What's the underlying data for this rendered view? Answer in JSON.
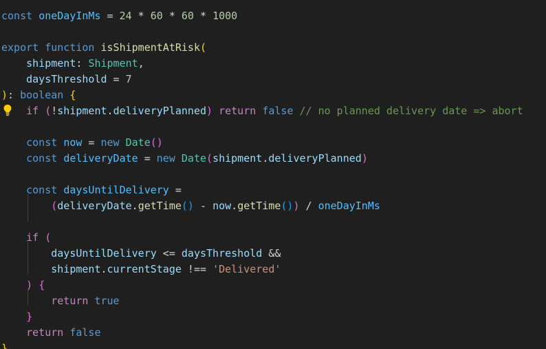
{
  "editor": {
    "lines": [
      [
        [
          "k",
          "const"
        ],
        [
          "p",
          " "
        ],
        [
          "cv",
          "oneDayInMs"
        ],
        [
          "p",
          " = "
        ],
        [
          "n",
          "24"
        ],
        [
          "p",
          " * "
        ],
        [
          "n",
          "60"
        ],
        [
          "p",
          " * "
        ],
        [
          "n",
          "60"
        ],
        [
          "p",
          " * "
        ],
        [
          "n",
          "1000"
        ]
      ],
      [],
      [
        [
          "k",
          "export"
        ],
        [
          "p",
          " "
        ],
        [
          "k",
          "function"
        ],
        [
          "p",
          " "
        ],
        [
          "fn",
          "isShipmentAtRisk"
        ],
        [
          "b1",
          "("
        ]
      ],
      [
        [
          "p",
          "    "
        ],
        [
          "v",
          "shipment"
        ],
        [
          "p",
          ": "
        ],
        [
          "ty",
          "Shipment"
        ],
        [
          "p",
          ","
        ]
      ],
      [
        [
          "p",
          "    "
        ],
        [
          "v",
          "daysThreshold"
        ],
        [
          "p",
          " = "
        ],
        [
          "n",
          "7"
        ]
      ],
      [
        [
          "b1",
          ")"
        ],
        [
          "p",
          ": "
        ],
        [
          "k",
          "boolean"
        ],
        [
          "p",
          " "
        ],
        [
          "b1",
          "{"
        ]
      ],
      [
        [
          "p",
          "    "
        ],
        [
          "kc",
          "if"
        ],
        [
          "p",
          " "
        ],
        [
          "b2",
          "("
        ],
        [
          "p",
          "!"
        ],
        [
          "v",
          "shipment"
        ],
        [
          "p",
          "."
        ],
        [
          "v",
          "deliveryPlanned"
        ],
        [
          "b2",
          ")"
        ],
        [
          "p",
          " "
        ],
        [
          "kc",
          "return"
        ],
        [
          "p",
          " "
        ],
        [
          "k",
          "false"
        ],
        [
          "p",
          " "
        ],
        [
          "c",
          "// no planned delivery date => abort"
        ]
      ],
      [],
      [
        [
          "p",
          "    "
        ],
        [
          "k",
          "const"
        ],
        [
          "p",
          " "
        ],
        [
          "cv",
          "now"
        ],
        [
          "p",
          " = "
        ],
        [
          "k",
          "new"
        ],
        [
          "p",
          " "
        ],
        [
          "ty",
          "Date"
        ],
        [
          "b2",
          "()"
        ]
      ],
      [
        [
          "p",
          "    "
        ],
        [
          "k",
          "const"
        ],
        [
          "p",
          " "
        ],
        [
          "cv",
          "deliveryDate"
        ],
        [
          "p",
          " = "
        ],
        [
          "k",
          "new"
        ],
        [
          "p",
          " "
        ],
        [
          "ty",
          "Date"
        ],
        [
          "b2",
          "("
        ],
        [
          "v",
          "shipment"
        ],
        [
          "p",
          "."
        ],
        [
          "v",
          "deliveryPlanned"
        ],
        [
          "b2",
          ")"
        ]
      ],
      [],
      [
        [
          "p",
          "    "
        ],
        [
          "k",
          "const"
        ],
        [
          "p",
          " "
        ],
        [
          "cv",
          "daysUntilDelivery"
        ],
        [
          "p",
          " ="
        ]
      ],
      [
        [
          "p",
          "        "
        ],
        [
          "b2",
          "("
        ],
        [
          "v",
          "deliveryDate"
        ],
        [
          "p",
          "."
        ],
        [
          "fn",
          "getTime"
        ],
        [
          "b3",
          "()"
        ],
        [
          "p",
          " - "
        ],
        [
          "v",
          "now"
        ],
        [
          "p",
          "."
        ],
        [
          "fn",
          "getTime"
        ],
        [
          "b3",
          "()"
        ],
        [
          "b2",
          ")"
        ],
        [
          "p",
          " / "
        ],
        [
          "cv",
          "oneDayInMs"
        ]
      ],
      [],
      [
        [
          "p",
          "    "
        ],
        [
          "kc",
          "if"
        ],
        [
          "p",
          " "
        ],
        [
          "b2",
          "("
        ]
      ],
      [
        [
          "p",
          "        "
        ],
        [
          "v",
          "daysUntilDelivery"
        ],
        [
          "p",
          " <= "
        ],
        [
          "v",
          "daysThreshold"
        ],
        [
          "p",
          " &&"
        ]
      ],
      [
        [
          "p",
          "        "
        ],
        [
          "v",
          "shipment"
        ],
        [
          "p",
          "."
        ],
        [
          "v",
          "currentStage"
        ],
        [
          "p",
          " !== "
        ],
        [
          "s",
          "'Delivered'"
        ]
      ],
      [
        [
          "p",
          "    "
        ],
        [
          "b2",
          ")"
        ],
        [
          "p",
          " "
        ],
        [
          "b2",
          "{"
        ]
      ],
      [
        [
          "p",
          "        "
        ],
        [
          "kc",
          "return"
        ],
        [
          "p",
          " "
        ],
        [
          "k",
          "true"
        ]
      ],
      [
        [
          "p",
          "    "
        ],
        [
          "b2",
          "}"
        ]
      ],
      [
        [
          "p",
          "    "
        ],
        [
          "kc",
          "return"
        ],
        [
          "p",
          " "
        ],
        [
          "k",
          "false"
        ]
      ],
      [
        [
          "b1",
          "}"
        ]
      ]
    ],
    "colors": {
      "background": "#1f1f1f",
      "keyword": "#569cd6",
      "control": "#c586c0",
      "function": "#dcdcaa",
      "variable": "#9cdcfe",
      "constant": "#4fc1ff",
      "type": "#4ec9b0",
      "number": "#b5cea8",
      "string": "#ce9178",
      "comment": "#6a9955",
      "lightbulb": "#ffcc00"
    },
    "gutter_icon": "lightbulb-icon"
  }
}
